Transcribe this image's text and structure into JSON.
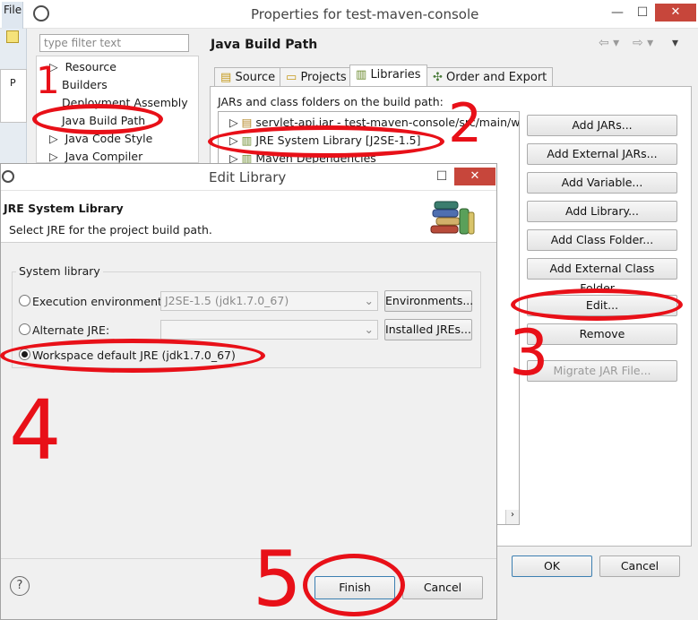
{
  "props": {
    "title": "Properties for test-maven-console",
    "menu_file": "File",
    "filter_placeholder": "type filter text",
    "tree": [
      "Resource",
      "Builders",
      "Deployment Assembly",
      "Java Build Path",
      "Java Code Style",
      "Java Compiler"
    ],
    "page_title": "Java Build Path",
    "tabs": [
      "Source",
      "Projects",
      "Libraries",
      "Order and Export"
    ],
    "jars_label": "JARs and class folders on the build path:",
    "libs": [
      "servlet-api.jar - test-maven-console/src/main/web",
      "JRE System Library [J2SE-1.5]",
      "Maven Dependencies"
    ],
    "buttons": [
      "Add JARs...",
      "Add External JARs...",
      "Add Variable...",
      "Add Library...",
      "Add Class Folder...",
      "Add External Class Folder...",
      "Edit...",
      "Remove",
      "Migrate JAR File..."
    ],
    "ok": "OK",
    "cancel": "Cancel",
    "left_tab_p": "P"
  },
  "dialog": {
    "title": "Edit Library",
    "heading": "JRE System Library",
    "subtitle": "Select JRE for the project build path.",
    "group_label": "System library",
    "exec_env_label": "Execution environment:",
    "exec_env_value": "J2SE-1.5 (jdk1.7.0_67)",
    "environments_btn": "Environments...",
    "alt_jre_label": "Alternate JRE:",
    "alt_jre_value": "",
    "installed_jres_btn": "Installed JREs...",
    "workspace_label": "Workspace default JRE (jdk1.7.0_67)",
    "help": "?",
    "finish": "Finish",
    "cancel": "Cancel"
  },
  "annotations": [
    "1",
    "2",
    "3",
    "4",
    "5"
  ],
  "colors": {
    "annotation_red": "#e81018",
    "close_red": "#c7463b"
  }
}
